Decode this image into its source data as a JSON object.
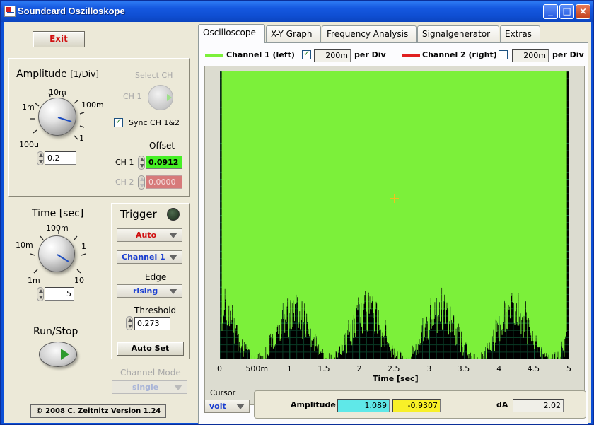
{
  "window": {
    "title": "Soundcard Oszilloskope",
    "min_label": "_",
    "max_label": "□",
    "close_label": "×"
  },
  "left": {
    "exit_label": "Exit",
    "amplitude": {
      "title": "Amplitude",
      "unit": "[1/Div]",
      "scale_labels": [
        "100u",
        "1m",
        "10m",
        "100m",
        "1"
      ],
      "value": "0.2",
      "select_ch_label": "Select CH",
      "ch1_label": "CH 1",
      "sync_label": "Sync CH 1&2",
      "sync_checked": true,
      "offset_label": "Offset",
      "offset_ch1_label": "CH 1",
      "offset_ch1_value": "0.0912",
      "offset_ch2_label": "CH 2",
      "offset_ch2_value": "0.0000"
    },
    "time": {
      "title": "Time [sec]",
      "scale_labels": [
        "1m",
        "10m",
        "100m",
        "1",
        "10"
      ],
      "value": "5"
    },
    "run_stop_label": "Run/Stop",
    "trigger": {
      "title": "Trigger",
      "mode": "Auto",
      "source": "Channel 1",
      "edge_label": "Edge",
      "edge": "rising",
      "threshold_label": "Threshold",
      "threshold": "0.273",
      "auto_set_label": "Auto Set"
    },
    "channel_mode_label": "Channel Mode",
    "channel_mode": "single",
    "copyright": "© 2008   C. Zeitnitz Version 1.24"
  },
  "tabs": [
    "Oscilloscope",
    "X-Y Graph",
    "Frequency Analysis",
    "Signalgenerator",
    "Extras"
  ],
  "active_tab": 0,
  "legend": {
    "ch1_label": "Channel 1 (left)",
    "ch1_checked": true,
    "ch1_div": "200m",
    "ch2_label": "Channel 2 (right)",
    "ch2_checked": false,
    "ch2_div": "200m",
    "per_div": "per Div"
  },
  "colors": {
    "ch1": "#7cf03a",
    "ch2": "#e02020",
    "plot_bg": "#000000",
    "grid": "#0f5a38"
  },
  "chart_data": {
    "type": "line",
    "xlabel": "Time [sec]",
    "x_ticks": [
      "0",
      "500m",
      "1",
      "1.5",
      "2",
      "2.5",
      "3",
      "3.5",
      "4",
      "4.5",
      "5"
    ],
    "xlim": [
      0,
      5
    ],
    "series": [
      {
        "name": "Channel 1 (left)",
        "upper_level": 1.089,
        "lower_level": -0.9307
      }
    ],
    "cursor_lines": [
      1.089,
      -0.9307
    ]
  },
  "bottom": {
    "cursor_label": "Cursor",
    "cursor_unit": "volt",
    "amplitude_label": "Amplitude",
    "amp1": "1.089",
    "amp2": "-0.9307",
    "da_label": "dA",
    "da_value": "2.02"
  }
}
